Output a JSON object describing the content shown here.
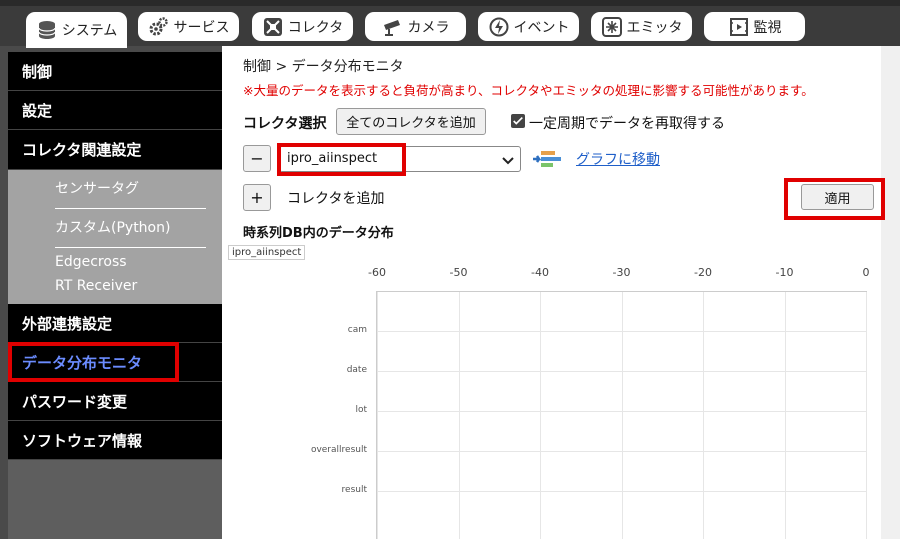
{
  "tabs": [
    {
      "label": "システム",
      "icon": "database-icon"
    },
    {
      "label": "サービス",
      "icon": "gears-icon"
    },
    {
      "label": "コレクタ",
      "icon": "collector-icon"
    },
    {
      "label": "カメラ",
      "icon": "camera-icon"
    },
    {
      "label": "イベント",
      "icon": "event-icon"
    },
    {
      "label": "エミッタ",
      "icon": "emitter-icon"
    },
    {
      "label": "監視",
      "icon": "monitor-icon"
    }
  ],
  "sidebar": {
    "items": [
      "制御",
      "設定",
      "コレクタ関連設定",
      "外部連携設定",
      "データ分布モニタ",
      "パスワード変更",
      "ソフトウェア情報"
    ],
    "sub_items": [
      "センサータグ",
      "カスタム(Python)",
      "Edgecross",
      "RT Receiver"
    ]
  },
  "breadcrumb": "制御 > データ分布モニタ",
  "warning": "※大量のデータを表示すると負荷が高まり、コレクタやエミッタの処理に影響する可能性があります。",
  "collector_select": {
    "label": "コレクタ選択",
    "add_all_button": "全てのコレクタを追加",
    "periodic_refresh_label": "一定周期でデータを再取得する",
    "periodic_refresh_checked": true,
    "remove_button": "−",
    "selected_value": "ipro_aiinspect",
    "graph_link": "グラフに移動",
    "add_button": "+",
    "add_label": "コレクタを追加",
    "apply_button": "適用"
  },
  "chart": {
    "section_title": "時系列DB内のデータ分布",
    "legend_tag": "ipro_aiinspect"
  },
  "chart_data": {
    "type": "scatter",
    "x_ticks": [
      "-60",
      "-50",
      "-40",
      "-30",
      "-20",
      "-10",
      "0"
    ],
    "xlim": [
      -60,
      0
    ],
    "categories": [
      "cam",
      "date",
      "lot",
      "overallresult",
      "result"
    ],
    "series": [],
    "grid": true,
    "legend_placement": "top-left"
  },
  "colors": {
    "highlight": "#e00000",
    "active_sidebar_text": "#6b8cff",
    "link": "#1f5fc9"
  }
}
